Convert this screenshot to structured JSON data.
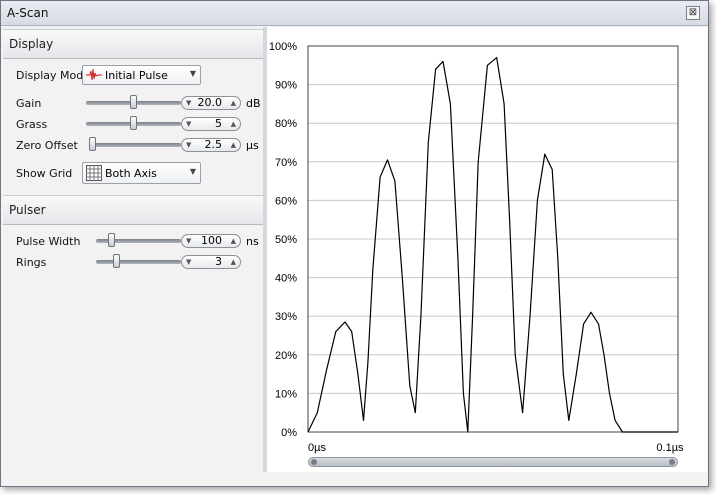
{
  "window": {
    "title": "A-Scan",
    "close_glyph": "⊠"
  },
  "display": {
    "header": "Display",
    "display_mode": {
      "label": "Display Mode",
      "value": "Initial Pulse",
      "icon": "waveform-icon"
    },
    "gain": {
      "label": "Gain",
      "value": "20.0",
      "unit": "dB",
      "slider_fraction": 0.5
    },
    "grass": {
      "label": "Grass",
      "value": "5",
      "unit": "",
      "slider_fraction": 0.5
    },
    "zero_offset": {
      "label": "Zero Offset",
      "value": "2.5",
      "unit": "µs",
      "slider_fraction": 0.0
    },
    "show_grid": {
      "label": "Show Grid",
      "value": "Both Axis",
      "icon": "grid-icon"
    }
  },
  "pulser": {
    "header": "Pulser",
    "pulse_width": {
      "label": "Pulse Width",
      "value": "100",
      "unit": "ns",
      "slider_fraction": 0.18
    },
    "rings": {
      "label": "Rings",
      "value": "3",
      "unit": "",
      "slider_fraction": 0.25
    }
  },
  "colors": {
    "trace": "#000000",
    "grid": "#c8c8c8",
    "panel": "#f2f2f2"
  },
  "chart_data": {
    "type": "line",
    "x_tick_labels": [
      "0µs",
      "0.1µs"
    ],
    "xlim": [
      0,
      0.1
    ],
    "ylim": [
      0,
      100
    ],
    "y_tick_labels": [
      "0%",
      "10%",
      "20%",
      "30%",
      "40%",
      "50%",
      "60%",
      "70%",
      "80%",
      "90%",
      "100%"
    ],
    "grid": "horizontal",
    "series": [
      {
        "x": [
          0,
          0.0025,
          0.005,
          0.0075,
          0.01,
          0.0118,
          0.0135,
          0.015,
          0.0162,
          0.0175,
          0.0195,
          0.0215,
          0.0235,
          0.0255,
          0.0275,
          0.029,
          0.0305,
          0.0325,
          0.0345,
          0.0365,
          0.0385,
          0.0405,
          0.042,
          0.0432,
          0.0445,
          0.046,
          0.0485,
          0.051,
          0.053,
          0.0545,
          0.056,
          0.058,
          0.06,
          0.062,
          0.064,
          0.066,
          0.0675,
          0.069,
          0.0705,
          0.0725,
          0.0745,
          0.0765,
          0.0785,
          0.08,
          0.0815,
          0.083,
          0.085,
          0.087,
          0.089,
          0.091,
          0.093,
          0.095,
          0.0975,
          0.1
        ],
        "y": [
          0,
          5,
          16,
          26,
          28.5,
          26,
          15,
          3,
          18,
          42,
          66,
          70.5,
          65,
          40,
          12,
          5,
          30,
          75,
          94,
          96,
          85,
          45,
          10,
          0,
          30,
          70,
          95,
          97,
          85,
          55,
          20,
          5,
          30,
          60,
          72,
          68,
          45,
          15,
          3,
          15,
          28,
          31,
          28,
          20,
          10,
          3,
          0,
          0,
          0,
          0,
          0,
          0,
          0,
          0
        ],
        "color": "#000000"
      }
    ]
  }
}
